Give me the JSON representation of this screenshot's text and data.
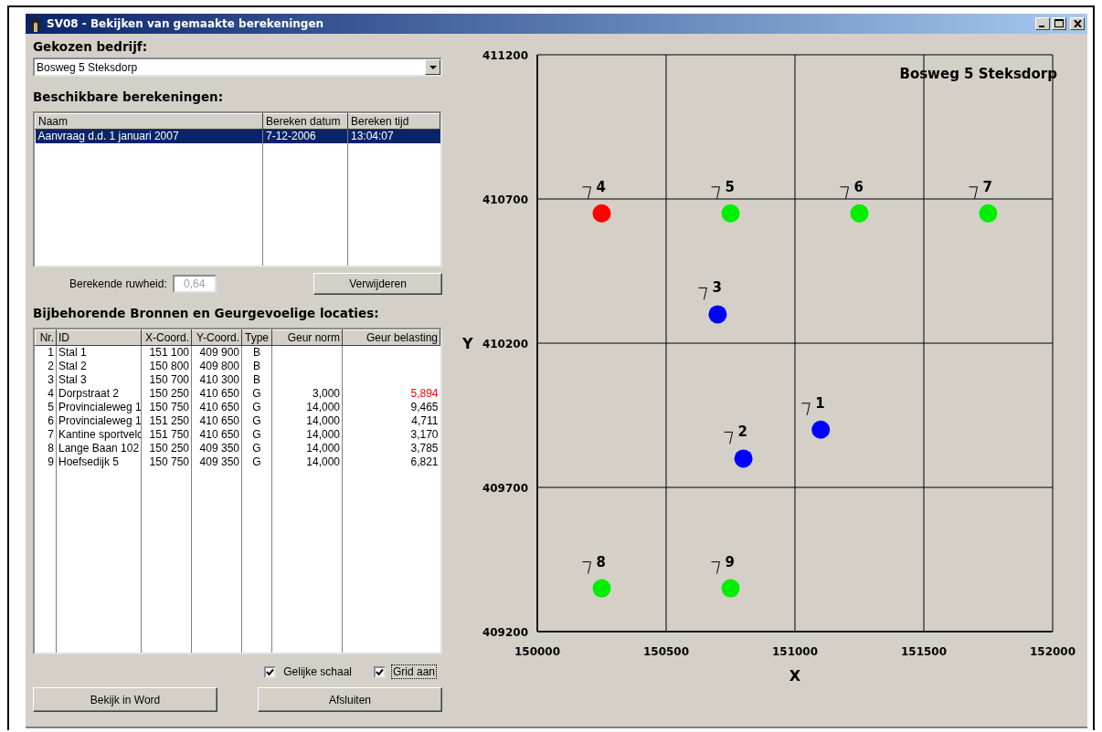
{
  "window": {
    "title": "SV08 - Bekijken van gemaakte berekeningen"
  },
  "company": {
    "label": "Gekozen bedrijf:",
    "value": "Bosweg 5 Steksdorp"
  },
  "calculations": {
    "label": "Beschikbare berekeningen:",
    "columns": [
      "Naam",
      "Bereken datum",
      "Bereken tijd"
    ],
    "rows": [
      {
        "cells": [
          "Aanvraag d.d. 1 januari 2007",
          "7-12-2006",
          "13:04:07"
        ],
        "selected": true
      }
    ]
  },
  "roughness": {
    "label": "Berekende ruwheid:",
    "value": "0,64",
    "disabled": true
  },
  "delete_button": {
    "label": "Verwijderen"
  },
  "sources": {
    "label": "Bijbehorende Bronnen en Geurgevoelige locaties:",
    "columns": [
      "Nr.",
      "ID",
      "X-Coord.",
      "Y-Coord.",
      "Type",
      "Geur norm",
      "Geur belasting"
    ],
    "rows": [
      {
        "nr": "1",
        "id": "Stal 1",
        "x": "151 100",
        "y": "409 900",
        "type": "B"
      },
      {
        "nr": "2",
        "id": "Stal 2",
        "x": "150 800",
        "y": "409 800",
        "type": "B"
      },
      {
        "nr": "3",
        "id": "Stal 3",
        "x": "150 700",
        "y": "410 300",
        "type": "B"
      },
      {
        "nr": "4",
        "id": "Dorpstraat 2",
        "x": "150 250",
        "y": "410 650",
        "type": "G",
        "norm": "3,000",
        "load": "5,894",
        "exceeded": true
      },
      {
        "nr": "5",
        "id": "Provincialeweg 1",
        "x": "150 750",
        "y": "410 650",
        "type": "G",
        "norm": "14,000",
        "load": "9,465",
        "exceeded": false
      },
      {
        "nr": "6",
        "id": "Provincialeweg 1",
        "x": "151 250",
        "y": "410 650",
        "type": "G",
        "norm": "14,000",
        "load": "4,711",
        "exceeded": false
      },
      {
        "nr": "7",
        "id": "Kantine sportvelc",
        "x": "151 750",
        "y": "410 650",
        "type": "G",
        "norm": "14,000",
        "load": "3,170",
        "exceeded": false
      },
      {
        "nr": "8",
        "id": "Lange Baan 102",
        "x": "150 250",
        "y": "409 350",
        "type": "G",
        "norm": "14,000",
        "load": "3,785",
        "exceeded": false
      },
      {
        "nr": "9",
        "id": "Hoefsedijk 5",
        "x": "150 750",
        "y": "409 350",
        "type": "G",
        "norm": "14,000",
        "load": "6,821",
        "exceeded": false
      }
    ]
  },
  "options": [
    {
      "label": "Gelijke schaal",
      "checked": true,
      "focused": false
    },
    {
      "label": "Grid aan",
      "checked": true,
      "focused": true
    }
  ],
  "buttons": [
    {
      "label": "Bekijk in Word"
    },
    {
      "label": "Afsluiten"
    }
  ],
  "chart": {
    "chart_data": {
      "type": "scatter",
      "title": "Bosweg 5 Steksdorp",
      "xlabel": "X",
      "ylabel": "Y",
      "xlim": [
        150000,
        152000
      ],
      "ylim": [
        409200,
        411200
      ],
      "xticks": [
        {
          "value": 150000,
          "label": "150000"
        },
        {
          "value": 150500,
          "label": "150500"
        },
        {
          "value": 151000,
          "label": "151000"
        },
        {
          "value": 151500,
          "label": "151500"
        },
        {
          "value": 152000,
          "label": "152000"
        }
      ],
      "yticks": [
        {
          "value": 409200,
          "label": "409200"
        },
        {
          "value": 409700,
          "label": "409700"
        },
        {
          "value": 410200,
          "label": "410200"
        },
        {
          "value": 410700,
          "label": "410700"
        },
        {
          "value": 411200,
          "label": "411200"
        }
      ],
      "grid": true,
      "x": [
        150250,
        150700,
        150750,
        150800,
        151100,
        151250,
        151750
      ],
      "series": [
        {
          "name": "4",
          "color": "#ff0000",
          "values": [
            410650,
            null,
            null,
            null,
            null,
            null,
            null
          ]
        },
        {
          "name": "5",
          "color": "#00ee00",
          "values": [
            null,
            null,
            410650,
            null,
            null,
            null,
            null
          ]
        },
        {
          "name": "6",
          "color": "#00ee00",
          "values": [
            null,
            null,
            null,
            null,
            null,
            410650,
            null
          ]
        },
        {
          "name": "7",
          "color": "#00ee00",
          "values": [
            null,
            null,
            null,
            null,
            null,
            null,
            410650
          ]
        },
        {
          "name": "3",
          "color": "#0000ff",
          "values": [
            null,
            410300,
            null,
            null,
            null,
            null,
            null
          ]
        },
        {
          "name": "1",
          "color": "#0000ff",
          "values": [
            null,
            null,
            null,
            null,
            409900,
            null,
            null
          ]
        },
        {
          "name": "2",
          "color": "#0000ff",
          "values": [
            null,
            null,
            null,
            409800,
            null,
            null,
            null
          ]
        },
        {
          "name": "8",
          "color": "#00ee00",
          "values": [
            409350,
            null,
            null,
            null,
            null,
            null,
            null
          ]
        },
        {
          "name": "9",
          "color": "#00ee00",
          "values": [
            null,
            null,
            409350,
            null,
            null,
            null,
            null
          ]
        }
      ]
    }
  }
}
